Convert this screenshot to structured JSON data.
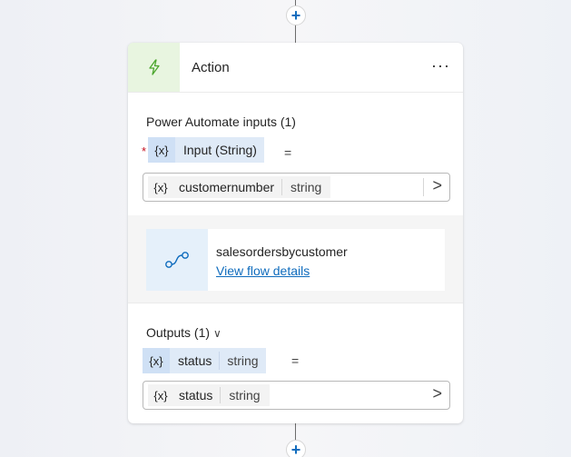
{
  "connectors": {
    "add_symbol": "+"
  },
  "card": {
    "title": "Action",
    "icon": "lightning-icon",
    "more_label": "···"
  },
  "inputs": {
    "section_title": "Power Automate inputs (1)",
    "required_marker": "*",
    "variable": {
      "prefix": "{x}",
      "name": "Input (String)",
      "equals": "="
    },
    "field": {
      "prefix": "{x}",
      "name": "customernumber",
      "type": "string",
      "chevron": ">"
    }
  },
  "flow": {
    "icon": "flow-connector-icon",
    "name": "salesordersbycustomer",
    "link_label": "View flow details"
  },
  "outputs": {
    "section_title": "Outputs (1)",
    "chevron": "∨",
    "variable": {
      "prefix": "{x}",
      "name": "status",
      "type": "string",
      "equals": "="
    },
    "field": {
      "prefix": "{x}",
      "name": "status",
      "type": "string",
      "chevron": ">"
    }
  },
  "colors": {
    "accent": "#0f6cbd",
    "action_icon_bg": "#e8f5e0",
    "action_icon": "#4ca62e",
    "required": "#c50f1f"
  }
}
